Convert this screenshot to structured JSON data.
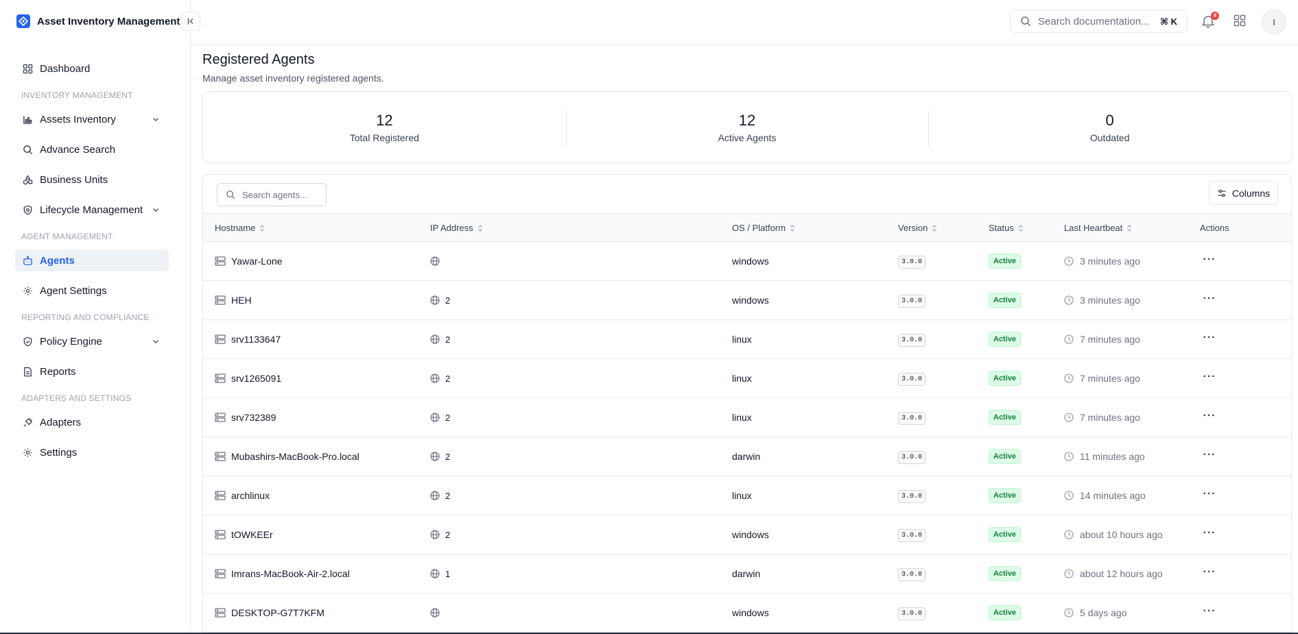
{
  "app": {
    "title": "Asset Inventory Management"
  },
  "header": {
    "search_placeholder": "Search documentation...",
    "search_shortcut": "⌘ K",
    "notification_count": "4",
    "avatar_initial": "I"
  },
  "sidebar": {
    "dashboard": "Dashboard",
    "sections": {
      "inventory": "INVENTORY MANAGEMENT",
      "agent": "AGENT MANAGEMENT",
      "reporting": "REPORTING AND COMPLIANCE",
      "adapters": "ADAPTERS AND SETTINGS"
    },
    "items": {
      "assets_inventory": "Assets Inventory",
      "advance_search": "Advance Search",
      "business_units": "Business Units",
      "lifecycle_management": "Lifecycle Management",
      "agents": "Agents",
      "agent_settings": "Agent Settings",
      "policy_engine": "Policy Engine",
      "reports": "Reports",
      "adapters": "Adapters",
      "settings": "Settings"
    },
    "active_item": "Agents"
  },
  "page": {
    "title": "Registered Agents",
    "subtitle": "Manage asset inventory registered agents."
  },
  "stats": [
    {
      "value": "12",
      "label": "Total Registered"
    },
    {
      "value": "12",
      "label": "Active Agents"
    },
    {
      "value": "0",
      "label": "Outdated"
    }
  ],
  "toolbar": {
    "search_placeholder": "Search agents...",
    "columns_label": "Columns"
  },
  "table": {
    "headers": {
      "hostname": "Hostname",
      "ip": "IP Address",
      "os": "OS / Platform",
      "version": "Version",
      "status": "Status",
      "heartbeat": "Last Heartbeat",
      "actions": "Actions"
    },
    "rows": [
      {
        "hostname": "Yawar-Lone",
        "ip": "",
        "os": "windows",
        "version": "3.0.0",
        "status": "Active",
        "heartbeat": "3 minutes ago"
      },
      {
        "hostname": "HEH",
        "ip": "2",
        "os": "windows",
        "version": "3.0.0",
        "status": "Active",
        "heartbeat": "3 minutes ago"
      },
      {
        "hostname": "srv1133647",
        "ip": "2",
        "os": "linux",
        "version": "3.0.0",
        "status": "Active",
        "heartbeat": "7 minutes ago"
      },
      {
        "hostname": "srv1265091",
        "ip": "2",
        "os": "linux",
        "version": "3.0.0",
        "status": "Active",
        "heartbeat": "7 minutes ago"
      },
      {
        "hostname": "srv732389",
        "ip": "2",
        "os": "linux",
        "version": "3.0.0",
        "status": "Active",
        "heartbeat": "7 minutes ago"
      },
      {
        "hostname": "Mubashirs-MacBook-Pro.local",
        "ip": "2",
        "os": "darwin",
        "version": "3.0.0",
        "status": "Active",
        "heartbeat": "11 minutes ago"
      },
      {
        "hostname": "archlinux",
        "ip": "2",
        "os": "linux",
        "version": "3.0.0",
        "status": "Active",
        "heartbeat": "14 minutes ago"
      },
      {
        "hostname": "tOWKEEr",
        "ip": "2",
        "os": "windows",
        "version": "3.0.0",
        "status": "Active",
        "heartbeat": "about 10 hours ago"
      },
      {
        "hostname": "Imrans-MacBook-Air-2.local",
        "ip": "1",
        "os": "darwin",
        "version": "3.0.0",
        "status": "Active",
        "heartbeat": "about 12 hours ago"
      },
      {
        "hostname": "DESKTOP-G7T7KFM",
        "ip": "",
        "os": "windows",
        "version": "3.0.0",
        "status": "Active",
        "heartbeat": "5 days ago"
      }
    ]
  },
  "colors": {
    "accent": "#2563eb",
    "status_active_bg": "#dcfce7",
    "status_active_text": "#15803d",
    "badge_red": "#ef4444"
  },
  "icons": {
    "brand": "logo-icon",
    "collapse": "sidebar-collapse-icon",
    "search": "search-icon",
    "bell": "bell-icon",
    "apps": "grid-icon",
    "server": "server-icon",
    "globe": "globe-icon",
    "clock": "clock-icon",
    "more": "more-horizontal-icon",
    "sort": "sort-icon",
    "columns": "sliders-icon"
  }
}
